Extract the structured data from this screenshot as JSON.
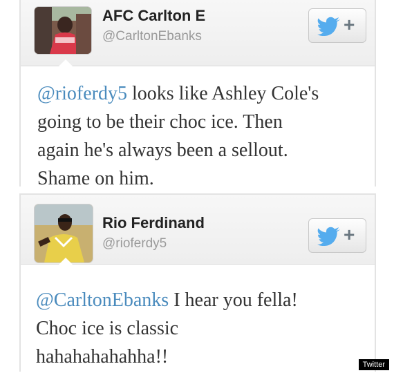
{
  "tweets": [
    {
      "name": "AFC Carlton E",
      "handle": "@CarltonEbanks",
      "mention": "@rioferdy5",
      "text_line1_rest": " looks like Ashley Cole's",
      "text_line2": "going to be their choc ice. Then",
      "text_line3": "again he's always been a sellout.",
      "text_line4": "Shame on him.",
      "follow_plus": "+"
    },
    {
      "name": "Rio Ferdinand",
      "handle": "@rioferdy5",
      "mention": "@CarltonEbanks",
      "text_line1_rest": " I hear you fella!",
      "text_line2": "Choc ice is classic",
      "text_line3": "hahahahahahha!!",
      "follow_plus": "+"
    }
  ],
  "watermark": "Twitter",
  "colors": {
    "mention": "#4a8bbd",
    "twitter_bird": "#55acee"
  }
}
